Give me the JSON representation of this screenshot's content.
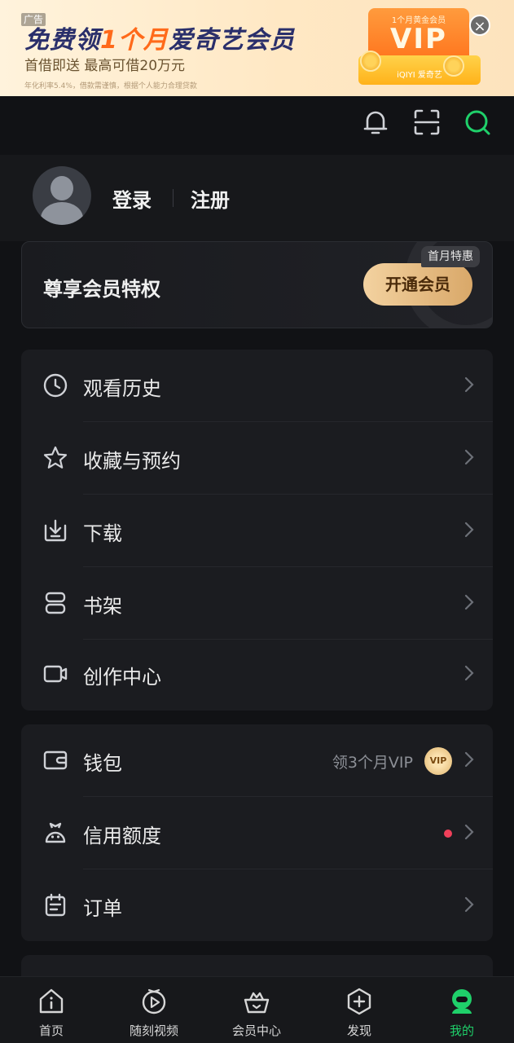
{
  "ad": {
    "tag": "广告",
    "title_part1": "免费领",
    "title_highlight": "1个月",
    "title_part2": "爱奇艺会员",
    "subtitle": "首借即送  最高可借20万元",
    "fine_print": "年化利率5.4%，借款需谨慎，根据个人能力合理贷款",
    "card_caption": "1个月黄金会员",
    "card_vip": "VIP",
    "card_brand": "iQIYI 爱奇艺",
    "close": "×"
  },
  "top_icons": [
    "bell-icon",
    "scan-icon",
    "search-icon"
  ],
  "profile": {
    "login": "登录",
    "register": "注册"
  },
  "vip_card": {
    "title": "尊享会员特权",
    "button": "开通会员",
    "badge": "首月特惠"
  },
  "menu_group1": [
    {
      "label": "观看历史",
      "icon": "clock-icon"
    },
    {
      "label": "收藏与预约",
      "icon": "star-icon"
    },
    {
      "label": "下载",
      "icon": "download-icon"
    },
    {
      "label": "书架",
      "icon": "bookshelf-icon"
    },
    {
      "label": "创作中心",
      "icon": "camera-icon"
    }
  ],
  "menu_group2": [
    {
      "label": "钱包",
      "icon": "wallet-icon",
      "hint": "领3个月VIP",
      "badge": "VIP"
    },
    {
      "label": "信用额度",
      "icon": "credit-icon"
    },
    {
      "label": "订单",
      "icon": "order-icon"
    }
  ],
  "tabs": [
    {
      "label": "首页",
      "icon": "home-icon"
    },
    {
      "label": "随刻视频",
      "icon": "video-icon"
    },
    {
      "label": "会员中心",
      "icon": "crown-basket-icon"
    },
    {
      "label": "发现",
      "icon": "discover-icon"
    },
    {
      "label": "我的",
      "icon": "profile-icon",
      "active": true
    }
  ],
  "colors": {
    "background": "#111215",
    "accent_green": "#1fd06a",
    "vip_gold": "#d9a869",
    "red_dot": "#f0405a"
  }
}
